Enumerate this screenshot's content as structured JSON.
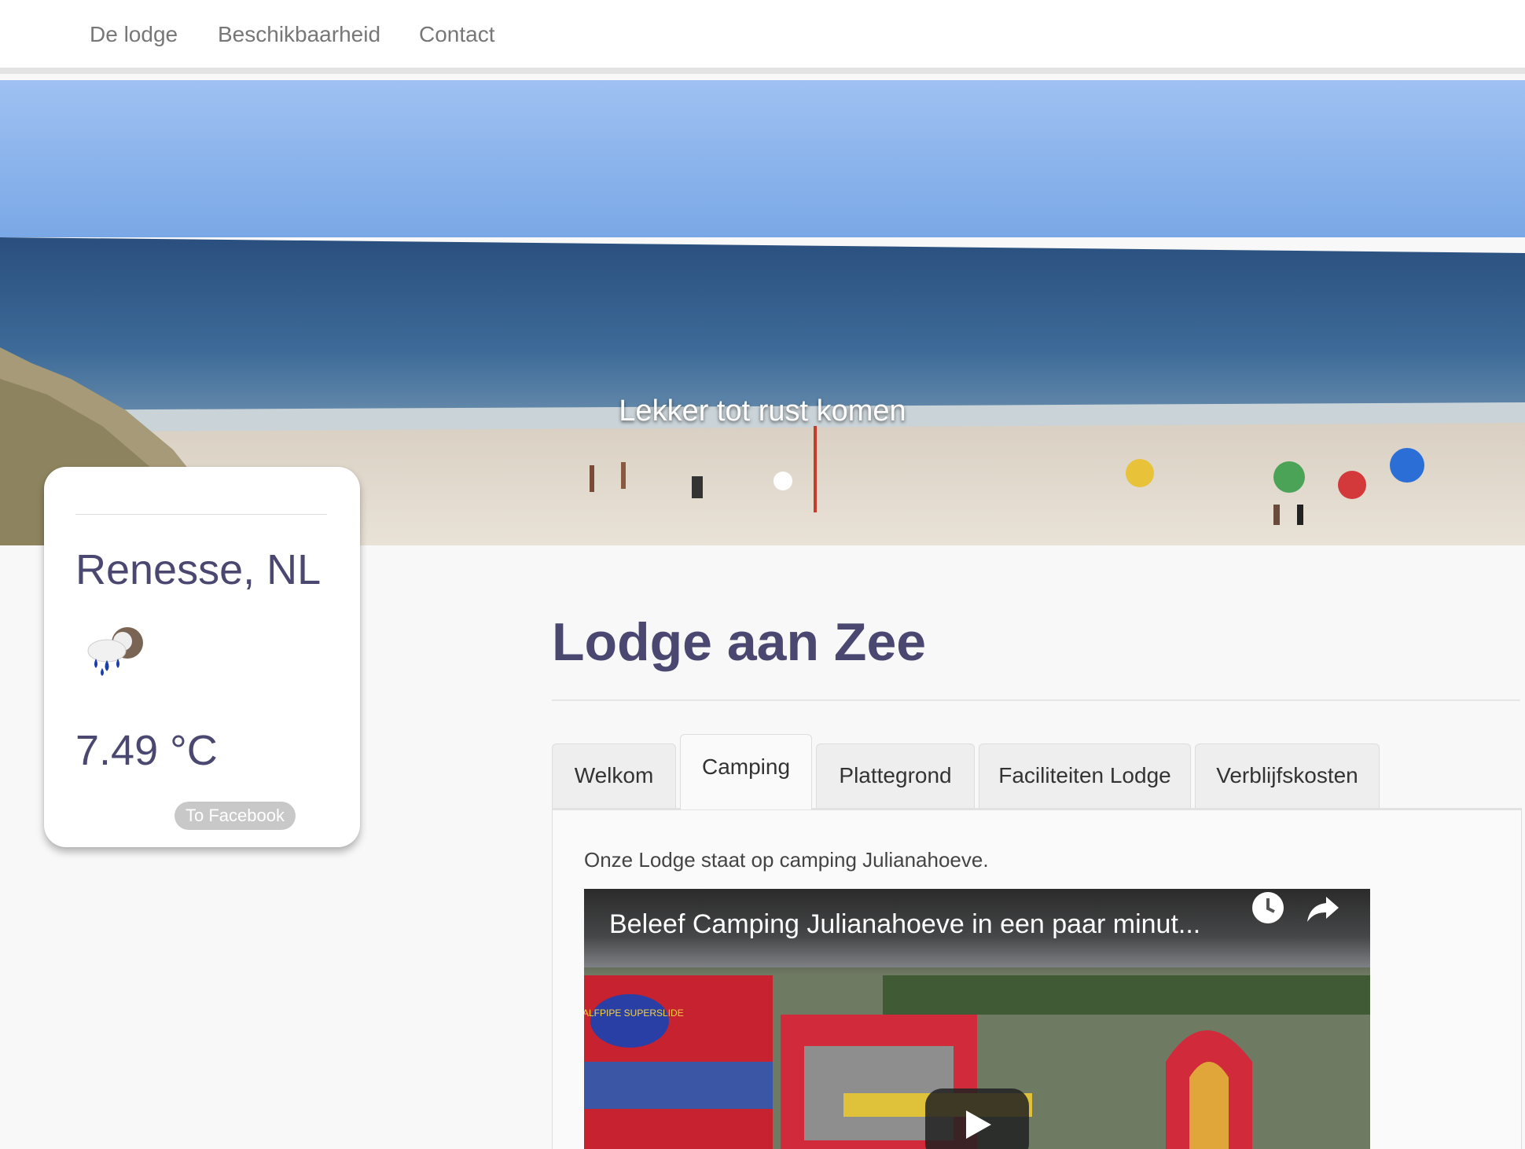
{
  "nav": {
    "items": [
      "De lodge",
      "Beschikbaarheid",
      "Contact"
    ]
  },
  "hero": {
    "caption": "Lekker tot rust komen"
  },
  "weather": {
    "city": "Renesse, NL",
    "icon": "rain-cloud-icon",
    "temperature": "7.49 °C",
    "facebook_label": "To Facebook"
  },
  "main": {
    "title": "Lodge aan Zee",
    "tabs": [
      "Welkom",
      "Camping",
      "Plattegrond",
      "Faciliteiten Lodge",
      "Verblijfskosten"
    ],
    "active_tab": "Camping",
    "camping_text": "Onze Lodge staat op camping Julianahoeve.",
    "video": {
      "title": "Beleef Camping Julianahoeve in een paar minut...",
      "badge_text": "HALFPIPE SUPERSLIDE"
    }
  },
  "colors": {
    "heading": "#4a4870",
    "tab_background": "#eeeeee",
    "navbar_background": "#ffffff"
  }
}
